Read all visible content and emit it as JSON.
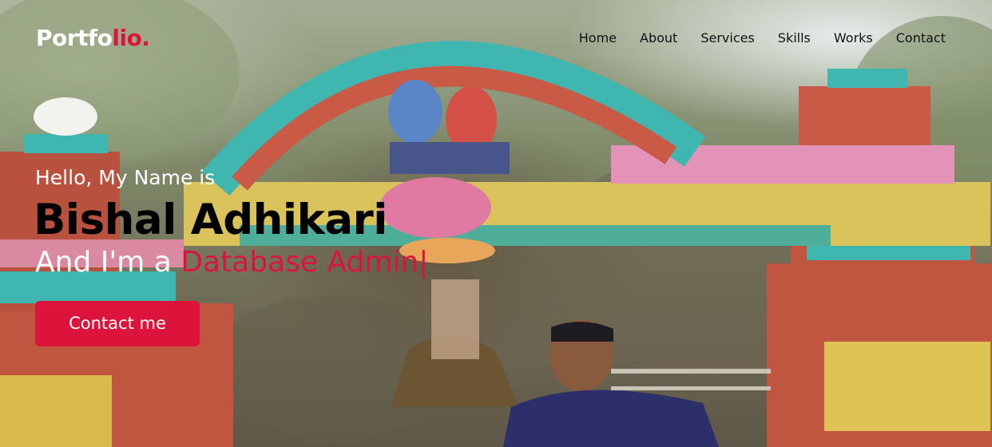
{
  "nav": {
    "logo_main": "Portfo",
    "logo_accent": "lio.",
    "items": [
      {
        "label": "Home"
      },
      {
        "label": "About"
      },
      {
        "label": "Services"
      },
      {
        "label": "Skills"
      },
      {
        "label": "Works"
      },
      {
        "label": "Contact"
      }
    ]
  },
  "hero": {
    "greeting": "Hello, My Name is",
    "name": "Bishal Adhikari",
    "role_prefix": "And I'm a ",
    "role_typed": "Database Admin",
    "cursor": "|",
    "cta_label": "Contact me"
  },
  "colors": {
    "accent": "#dc143c",
    "nav_text": "#111111",
    "heading_text": "#000000",
    "light_text": "#ffffff"
  }
}
